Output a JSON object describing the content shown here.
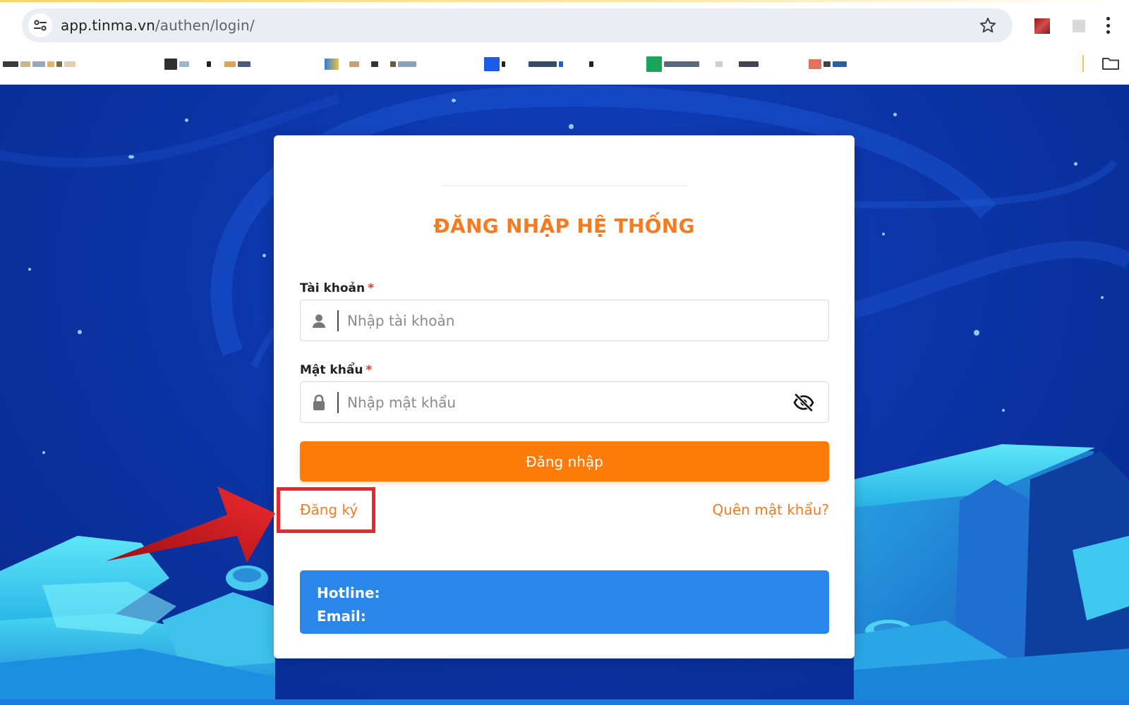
{
  "browser": {
    "url_host": "app.tinma.vn",
    "url_path": "/authen/login/"
  },
  "login": {
    "title": "ĐĂNG NHẬP HỆ THỐNG",
    "account_label": "Tài khoản",
    "account_placeholder": "Nhập tài khoản",
    "password_label": "Mật khẩu",
    "password_placeholder": "Nhập mật khẩu",
    "required_mark": "*",
    "submit_label": "Đăng nhập",
    "register_label": "Đăng ký",
    "forgot_label": "Quên mật khẩu?",
    "hotline_label": "Hotline:",
    "email_label": "Email:"
  },
  "colors": {
    "accent_orange": "#fc7b09",
    "title_orange": "#f47b20",
    "info_blue": "#2b86e9",
    "highlight_red": "#e8262b"
  },
  "icons": {
    "site_info": "tune-icon",
    "bookmark": "star-icon",
    "account": "user-icon",
    "password": "lock-icon",
    "toggle_visibility": "eye-slash-icon",
    "folder": "folder-icon",
    "callout": "arrow-icon"
  }
}
